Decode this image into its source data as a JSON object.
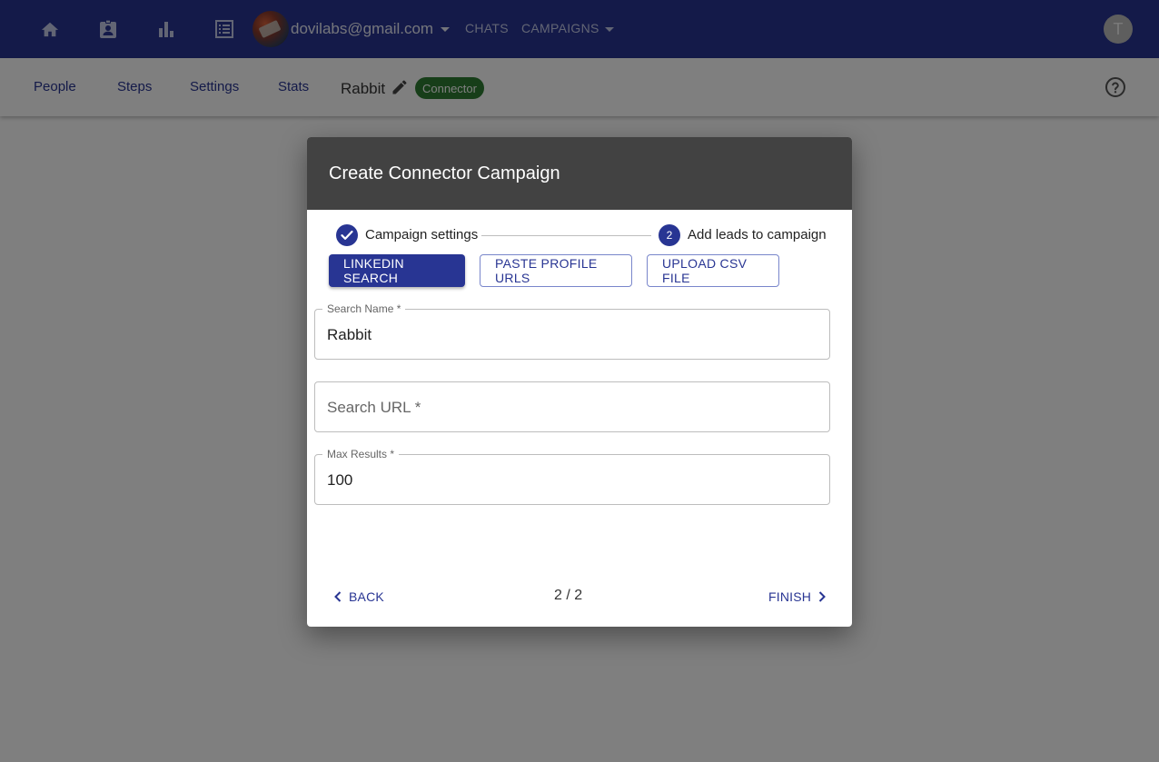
{
  "appbar": {
    "email": "dovilabs@gmail.com",
    "chats_label": "CHATS",
    "campaigns_label": "CAMPAIGNS",
    "user_initial": "T"
  },
  "subnav": {
    "tabs": [
      "People",
      "Steps",
      "Settings",
      "Stats"
    ],
    "campaign_name": "Rabbit",
    "type_badge": "Connector"
  },
  "dialog": {
    "title": "Create Connector Campaign",
    "steps": [
      {
        "label": "Campaign settings",
        "status": "completed"
      },
      {
        "label": "Add leads to campaign",
        "number": "2",
        "status": "active"
      }
    ],
    "source_buttons": [
      "LINKEDIN SEARCH",
      "PASTE PROFILE URLS",
      "UPLOAD CSV FILE"
    ],
    "fields": {
      "search_name": {
        "label": "Search Name *",
        "value": "Rabbit"
      },
      "search_url": {
        "label": "Search URL *",
        "value": ""
      },
      "max_results": {
        "label": "Max Results *",
        "value": "100"
      }
    },
    "footer": {
      "back_label": "BACK",
      "pager": "2 / 2",
      "finish_label": "FINISH"
    }
  },
  "colors": {
    "primary": "#283593",
    "dialog_header": "#424242",
    "badge_green": "#2e7d32"
  }
}
